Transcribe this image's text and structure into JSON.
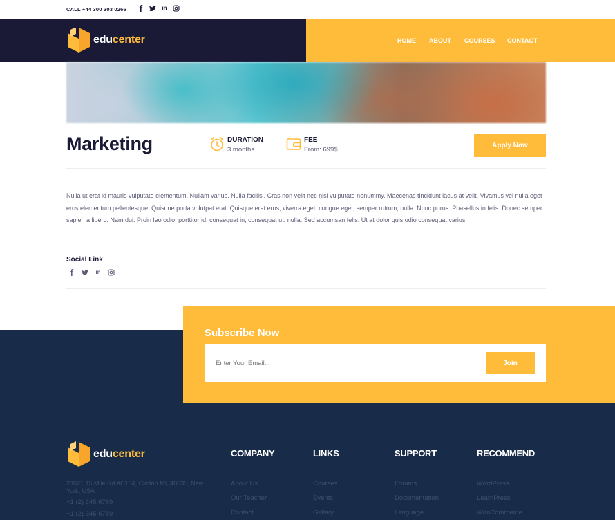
{
  "topbar": {
    "call": "CALL +44 300 303 0266",
    "social": [
      "f",
      "t",
      "in",
      "ig"
    ]
  },
  "brand": {
    "part1": "edu",
    "part2": "center"
  },
  "nav": [
    "HOME",
    "ABOUT",
    "COURSES",
    "CONTACT"
  ],
  "course": {
    "title": "Marketing",
    "duration_label": "DURATION",
    "duration_value": "3 months",
    "fee_label": "FEE",
    "fee_value": "From: 699$",
    "apply_label": "Apply Now",
    "description": "Nulla ut erat id mauris vulputate elementum. Nullam varius. Nulla facilisi. Cras non velit nec nisi vulputate nonummy. Maecenas tincidunt lacus at velit. Vivamus vel nulla eget eros elementum pellentesque. Quisque porta volutpat erat. Quisque erat eros, viverra eget, congue eget, semper rutrum, nulla. Nunc purus. Phasellus in felis. Donec semper sapien a libero. Nam dui. Proin leo odio, porttitor id, consequat in, consequat ut, nulla. Sed accumsan felis. Ut at dolor quis odio consequat varius.",
    "social_title": "Social Link"
  },
  "subscribe": {
    "title": "Subscribe Now",
    "placeholder": "Enter Your Email...",
    "join_label": "Join"
  },
  "footer": {
    "address": "23621 15 Mile Rd #C104, Clinton MI, 48035, New York, USA",
    "phones": [
      "+1 (2) 345 6789",
      "+1 (2) 345 6789"
    ],
    "columns": [
      {
        "title": "COMPANY",
        "links": [
          "About Us",
          "Our Teacher",
          "Contact"
        ]
      },
      {
        "title": "LINKS",
        "links": [
          "Courses",
          "Events",
          "Gallary"
        ]
      },
      {
        "title": "SUPPORT",
        "links": [
          "Forums",
          "Documentation",
          "Language"
        ]
      },
      {
        "title": "RECOMMEND",
        "links": [
          "WordPress",
          "LearnPress",
          "WooCommerce"
        ]
      }
    ]
  },
  "colors": {
    "navy": "#1a1a37",
    "accent": "#ffbc3b",
    "footer": "#182b49"
  }
}
